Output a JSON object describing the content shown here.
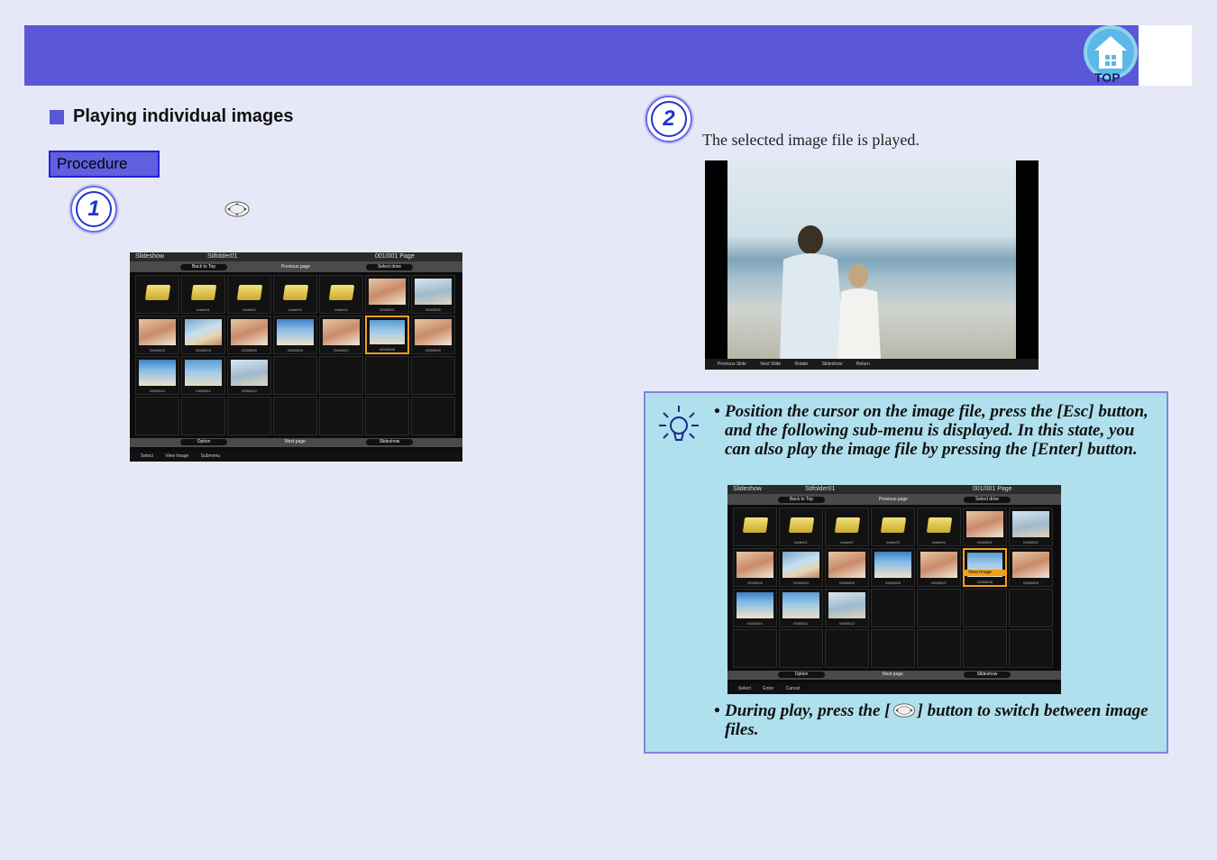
{
  "header": {
    "top_button_label": "TOP"
  },
  "section": {
    "title": "Playing individual images"
  },
  "procedure": {
    "label": "Procedure"
  },
  "steps": [
    {
      "number": "1"
    },
    {
      "number": "2",
      "description": "The selected image file is played."
    }
  ],
  "slideshow_screen": {
    "title": "Slideshow",
    "folder": "Stifolder01",
    "page": "001/001 Page",
    "back_to_top": "Back to Top",
    "previous_page": "Previous page",
    "select_drive": "Select drive",
    "option": "Option",
    "next_page": "Next page",
    "slideshow": "Slideshow",
    "footer": [
      "Select",
      "View Image",
      "Submenu"
    ],
    "submenu_footer": [
      "Select",
      "Enter",
      "Cancel"
    ],
    "view_image": "View Image",
    "items": [
      "",
      "folder01",
      "folder02",
      "folder03",
      "folder04",
      "I0000001",
      "I0000002",
      "I0000003",
      "I0000004",
      "I0000005",
      "I0000006",
      "I0000007",
      "I0000008",
      "I0000009",
      "I0000010",
      "I0000011",
      "I0000012"
    ]
  },
  "play_screen": {
    "footer": [
      "Previous Slide",
      "Next Slide",
      "Rotate",
      "Slideshow",
      "Return"
    ]
  },
  "tips": [
    "Position the cursor on the image file, press the [Esc] button, and the following sub-menu is displayed. In this state, you can also play the image file by pressing the [Enter] button.",
    "During play, press the [",
    "] button to switch between image files."
  ],
  "colors": {
    "header": "#5a58d6",
    "tip_bg": "#b0e0ee",
    "accent": "#2233cc"
  }
}
